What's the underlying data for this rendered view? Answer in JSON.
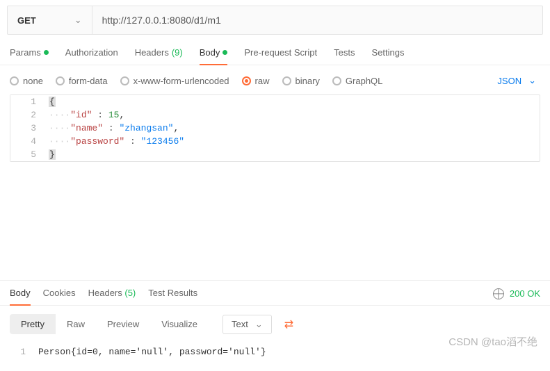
{
  "request": {
    "method": "GET",
    "url": "http://127.0.0.1:8080/d1/m1"
  },
  "request_tabs": {
    "params": "Params",
    "authorization": "Authorization",
    "headers": "Headers",
    "headers_count": "(9)",
    "body": "Body",
    "prerequest": "Pre-request Script",
    "tests": "Tests",
    "settings": "Settings"
  },
  "body_opts": {
    "none": "none",
    "formdata": "form-data",
    "xwww": "x-www-form-urlencoded",
    "raw": "raw",
    "binary": "binary",
    "graphql": "GraphQL",
    "json": "JSON"
  },
  "payload": {
    "lineno": [
      "1",
      "2",
      "3",
      "4",
      "5"
    ],
    "key_id": "\"id\"",
    "val_id": "15",
    "comma1": ",",
    "key_name": "\"name\"",
    "val_name": "\"zhangsan\"",
    "comma2": ",",
    "key_pw": "\"password\"",
    "val_pw": "\"123456\"",
    "brace_open": "{",
    "brace_close": "}",
    "colon": " : "
  },
  "response_tabs": {
    "body": "Body",
    "cookies": "Cookies",
    "headers": "Headers",
    "headers_count": "(5)",
    "test_results": "Test Results"
  },
  "response_status": "200 OK",
  "view_modes": {
    "pretty": "Pretty",
    "raw": "Raw",
    "preview": "Preview",
    "visualize": "Visualize",
    "text": "Text"
  },
  "response_body": {
    "lineno": "1",
    "text": "Person{id=0, name='null', password='null'}"
  },
  "watermark": "CSDN @tao滔不绝"
}
